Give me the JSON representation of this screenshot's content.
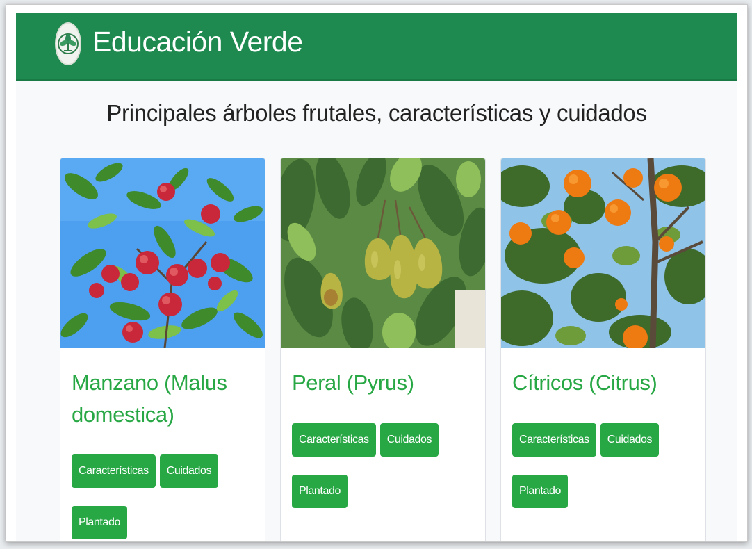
{
  "header": {
    "brand": "Educación Verde",
    "logo_icon": "leaf-emblem-icon",
    "background_color": "#1e8a50"
  },
  "main": {
    "heading": "Principales árboles frutales, características y cuidados",
    "accent_color": "#28a745",
    "cards": [
      {
        "title": "Manzano (Malus domestica)",
        "image": "apple-tree-image",
        "buttons": [
          "Características",
          "Cuidados",
          "Plantado"
        ]
      },
      {
        "title": "Peral (Pyrus)",
        "image": "pear-tree-image",
        "buttons": [
          "Características",
          "Cuidados",
          "Plantado"
        ]
      },
      {
        "title": "Cítricos (Citrus)",
        "image": "orange-tree-image",
        "buttons": [
          "Características",
          "Cuidados",
          "Plantado"
        ]
      }
    ]
  }
}
